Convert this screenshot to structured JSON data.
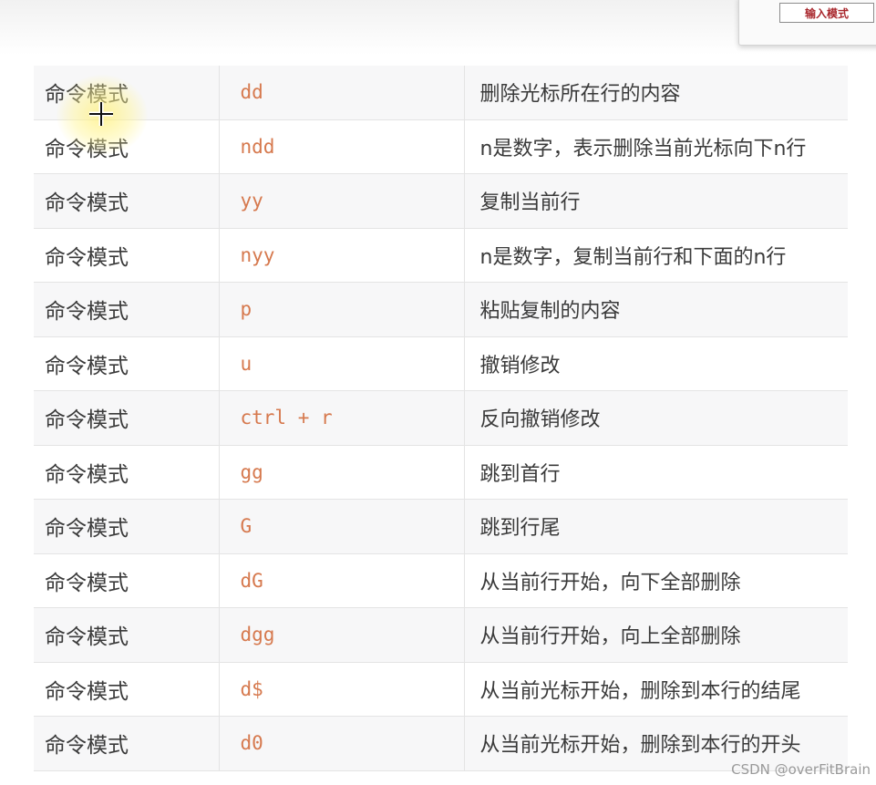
{
  "mode_indicator": {
    "label": "输入模式"
  },
  "table": {
    "rows": [
      {
        "mode": "命令模式",
        "command": "dd",
        "description": "删除光标所在行的内容"
      },
      {
        "mode": "命令模式",
        "command": "ndd",
        "description": "n是数字，表示删除当前光标向下n行"
      },
      {
        "mode": "命令模式",
        "command": "yy",
        "description": "复制当前行"
      },
      {
        "mode": "命令模式",
        "command": "nyy",
        "description": "n是数字，复制当前行和下面的n行"
      },
      {
        "mode": "命令模式",
        "command": "p",
        "description": "粘贴复制的内容"
      },
      {
        "mode": "命令模式",
        "command": "u",
        "description": "撤销修改"
      },
      {
        "mode": "命令模式",
        "command": "ctrl + r",
        "description": "反向撤销修改"
      },
      {
        "mode": "命令模式",
        "command": "gg",
        "description": "跳到首行"
      },
      {
        "mode": "命令模式",
        "command": "G",
        "description": "跳到行尾"
      },
      {
        "mode": "命令模式",
        "command": "dG",
        "description": "从当前行开始，向下全部删除"
      },
      {
        "mode": "命令模式",
        "command": "dgg",
        "description": "从当前行开始，向上全部删除"
      },
      {
        "mode": "命令模式",
        "command": "d$",
        "description": "从当前光标开始，删除到本行的结尾"
      },
      {
        "mode": "命令模式",
        "command": "d0",
        "description": "从当前光标开始，删除到本行的开头"
      }
    ]
  },
  "watermark": "CSDN @overFitBrain",
  "colors": {
    "command_text": "#d6794e",
    "body_text": "#3a3a3a",
    "badge_text": "#a8262c",
    "row_stripe": "#f7f7f8"
  },
  "icons": {
    "cursor": "crosshair-icon"
  }
}
